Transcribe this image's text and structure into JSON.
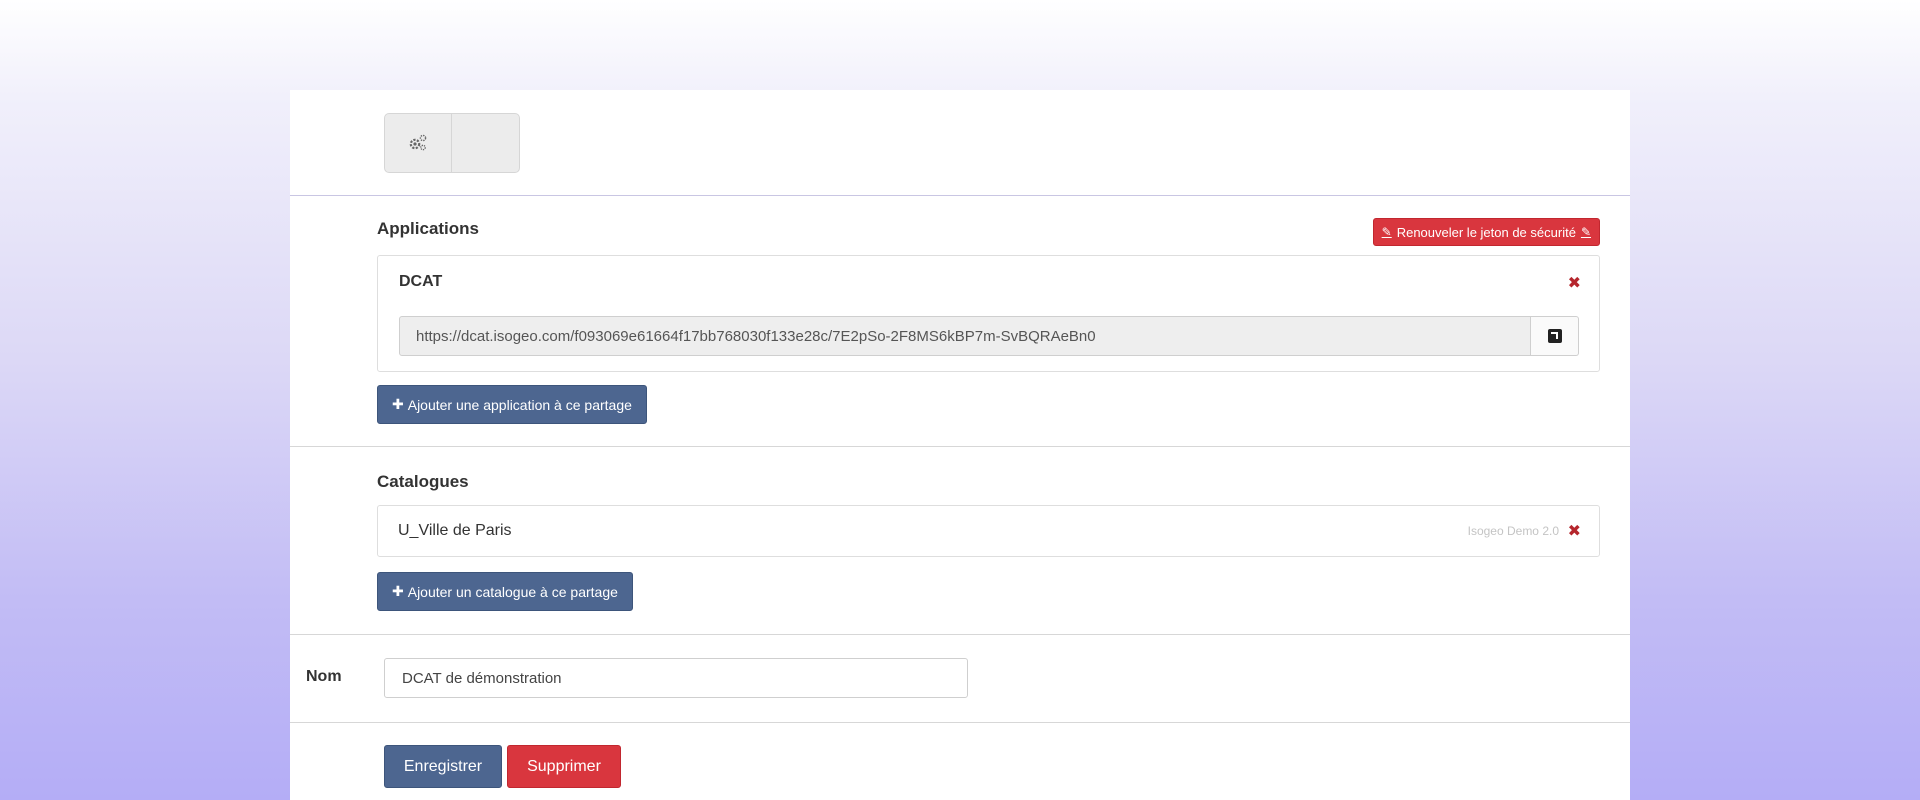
{
  "toolbar": {
    "settings_icon": "gears-icon"
  },
  "applications": {
    "title": "Applications",
    "renew_token_label": "Renouveler le jeton de sécurité",
    "items": [
      {
        "name": "DCAT",
        "url": "https://dcat.isogeo.com/f093069e61664f17bb768030f133e28c/7E2pSo-2F8MS6kBP7m-SvBQRAeBn0"
      }
    ],
    "add_label": "Ajouter une application à ce partage"
  },
  "catalogs": {
    "title": "Catalogues",
    "items": [
      {
        "name": "U_Ville de Paris",
        "owner": "Isogeo Demo 2.0"
      }
    ],
    "add_label": "Ajouter un catalogue à ce partage"
  },
  "name_field": {
    "label": "Nom",
    "value": "DCAT de démonstration"
  },
  "actions": {
    "save_label": "Enregistrer",
    "delete_label": "Supprimer"
  },
  "colors": {
    "primary": "#4d6690",
    "danger": "#d9363e",
    "remove": "#b5262d"
  }
}
